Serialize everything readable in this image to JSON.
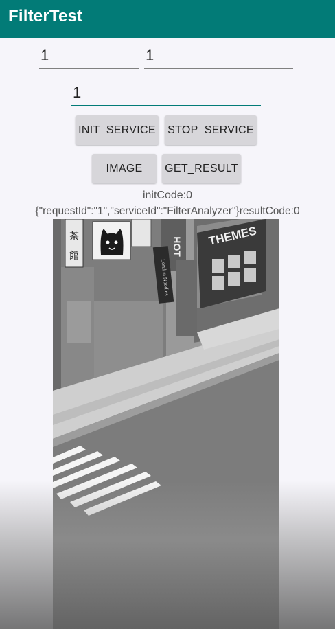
{
  "app": {
    "title": "FilterTest"
  },
  "inputs": {
    "first": "1",
    "second": "1",
    "third": "1"
  },
  "buttons": {
    "init_service": "INIT_SERVICE",
    "stop_service": "STOP_SERVICE",
    "image": "IMAGE",
    "get_result": "GET_RESULT"
  },
  "results": {
    "init_code": "initCode:0",
    "result_line": "{\"requestId\":\"1\",\"serviceId\":\"FilterAnalyzer\"}resultCode:0"
  },
  "image": {
    "shop_sign": "THEMES",
    "hotel_sign": "HOT",
    "stand_sign": "London Noodles",
    "kanji_sign": "茶館"
  },
  "colors": {
    "appbar": "#027b77",
    "accent": "#027b77",
    "background": "#f6f5fa",
    "button": "#d7d6da"
  }
}
